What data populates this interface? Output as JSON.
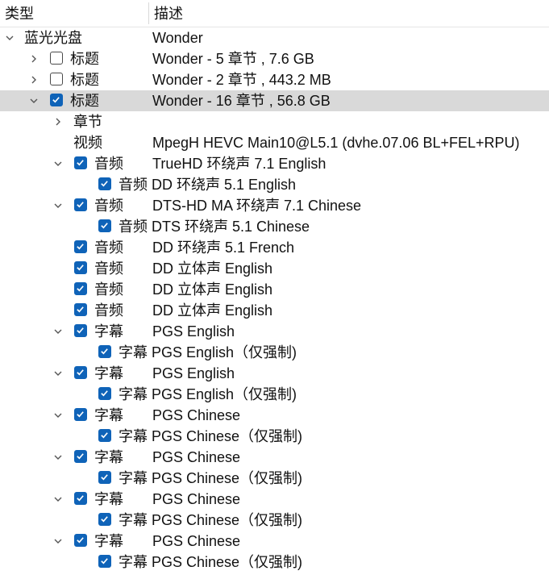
{
  "header": {
    "type_label": "类型",
    "desc_label": "描述"
  },
  "rows": [
    {
      "level": 0,
      "chevron": "down",
      "checkbox": false,
      "checked": false,
      "type": "蓝光光盘",
      "desc": "Wonder",
      "selected": false
    },
    {
      "level": 1,
      "chevron": "right",
      "checkbox": true,
      "checked": false,
      "type": "标题",
      "desc": "Wonder - 5 章节 , 7.6 GB",
      "selected": false
    },
    {
      "level": 1,
      "chevron": "right",
      "checkbox": true,
      "checked": false,
      "type": "标题",
      "desc": "Wonder - 2 章节 , 443.2 MB",
      "selected": false
    },
    {
      "level": 1,
      "chevron": "down",
      "checkbox": true,
      "checked": true,
      "type": "标题",
      "desc": "Wonder - 16 章节 , 56.8 GB",
      "selected": true
    },
    {
      "level": 2,
      "chevron": "right",
      "checkbox": false,
      "checked": false,
      "type": "章节",
      "desc": "",
      "selected": false
    },
    {
      "level": 2,
      "chevron": "none",
      "checkbox": false,
      "checked": false,
      "type": "视频",
      "desc": "MpegH HEVC Main10@L5.1 (dvhe.07.06 BL+FEL+RPU)",
      "selected": false
    },
    {
      "level": 2,
      "chevron": "down",
      "checkbox": true,
      "checked": true,
      "type": "音频",
      "desc": "TrueHD 环绕声 7.1 English",
      "selected": false
    },
    {
      "level": 3,
      "chevron": "none",
      "checkbox": true,
      "checked": true,
      "type": "音频",
      "desc": "DD 环绕声 5.1 English",
      "selected": false
    },
    {
      "level": 2,
      "chevron": "down",
      "checkbox": true,
      "checked": true,
      "type": "音频",
      "desc": "DTS-HD MA 环绕声 7.1 Chinese",
      "selected": false
    },
    {
      "level": 3,
      "chevron": "none",
      "checkbox": true,
      "checked": true,
      "type": "音频",
      "desc": "DTS 环绕声 5.1 Chinese",
      "selected": false
    },
    {
      "level": 2,
      "chevron": "none",
      "checkbox": true,
      "checked": true,
      "type": "音频",
      "desc": "DD 环绕声 5.1 French",
      "selected": false
    },
    {
      "level": 2,
      "chevron": "none",
      "checkbox": true,
      "checked": true,
      "type": "音频",
      "desc": "DD 立体声 English",
      "selected": false
    },
    {
      "level": 2,
      "chevron": "none",
      "checkbox": true,
      "checked": true,
      "type": "音频",
      "desc": "DD 立体声 English",
      "selected": false
    },
    {
      "level": 2,
      "chevron": "none",
      "checkbox": true,
      "checked": true,
      "type": "音频",
      "desc": "DD 立体声 English",
      "selected": false
    },
    {
      "level": 2,
      "chevron": "down",
      "checkbox": true,
      "checked": true,
      "type": "字幕",
      "desc": "PGS English",
      "selected": false
    },
    {
      "level": 3,
      "chevron": "none",
      "checkbox": true,
      "checked": true,
      "type": "字幕",
      "desc": "PGS English（仅强制)",
      "selected": false
    },
    {
      "level": 2,
      "chevron": "down",
      "checkbox": true,
      "checked": true,
      "type": "字幕",
      "desc": "PGS English",
      "selected": false
    },
    {
      "level": 3,
      "chevron": "none",
      "checkbox": true,
      "checked": true,
      "type": "字幕",
      "desc": "PGS English（仅强制)",
      "selected": false
    },
    {
      "level": 2,
      "chevron": "down",
      "checkbox": true,
      "checked": true,
      "type": "字幕",
      "desc": "PGS Chinese",
      "selected": false
    },
    {
      "level": 3,
      "chevron": "none",
      "checkbox": true,
      "checked": true,
      "type": "字幕",
      "desc": "PGS Chinese（仅强制)",
      "selected": false
    },
    {
      "level": 2,
      "chevron": "down",
      "checkbox": true,
      "checked": true,
      "type": "字幕",
      "desc": "PGS Chinese",
      "selected": false
    },
    {
      "level": 3,
      "chevron": "none",
      "checkbox": true,
      "checked": true,
      "type": "字幕",
      "desc": "PGS Chinese（仅强制)",
      "selected": false
    },
    {
      "level": 2,
      "chevron": "down",
      "checkbox": true,
      "checked": true,
      "type": "字幕",
      "desc": "PGS Chinese",
      "selected": false
    },
    {
      "level": 3,
      "chevron": "none",
      "checkbox": true,
      "checked": true,
      "type": "字幕",
      "desc": "PGS Chinese（仅强制)",
      "selected": false
    },
    {
      "level": 2,
      "chevron": "down",
      "checkbox": true,
      "checked": true,
      "type": "字幕",
      "desc": "PGS Chinese",
      "selected": false
    },
    {
      "level": 3,
      "chevron": "none",
      "checkbox": true,
      "checked": true,
      "type": "字幕",
      "desc": "PGS Chinese（仅强制)",
      "selected": false
    }
  ],
  "colors": {
    "checkbox_checked": "#0f63b8",
    "selection": "#d9d9d9"
  },
  "icons": {
    "expanded": "chevron-down-icon",
    "collapsed": "chevron-right-icon",
    "checkmark": "checkmark-icon"
  }
}
